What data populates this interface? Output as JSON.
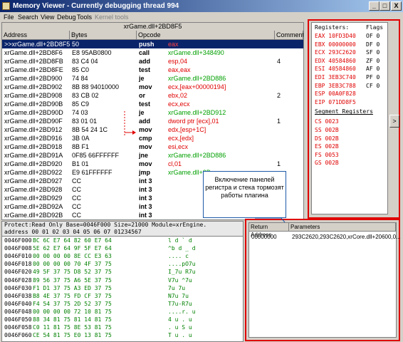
{
  "window": {
    "title": "Memory Viewer - Currently debugging thread 994",
    "minimize": "_",
    "maximize": "□",
    "close": "X"
  },
  "menu": [
    "File",
    "Search",
    "View",
    "Debug",
    "Tools",
    "Kernel tools"
  ],
  "disassembler": {
    "header": "xrGame.dll+2BD8F5",
    "columns": [
      "Address",
      "Bytes",
      "Opcode",
      "Comment"
    ],
    "rows": [
      {
        "addr": ">>xrGame.dll+2BD8F5",
        "bytes": "50",
        "mn": "push",
        "op": "eax",
        "cm": "",
        "sel": true
      },
      {
        "addr": "xrGame.dll+2BD8F6",
        "bytes": "E8 95AB0800",
        "mn": "call",
        "op": "xrGame.dll+348490",
        "cm": ""
      },
      {
        "addr": "xrGame.dll+2BD8FB",
        "bytes": "83 C4 04",
        "mn": "add",
        "op": "esp,04",
        "cm": "4"
      },
      {
        "addr": "xrGame.dll+2BD8FE",
        "bytes": "85 C0",
        "mn": "test",
        "op": "eax,eax",
        "cm": ""
      },
      {
        "addr": "xrGame.dll+2BD900",
        "bytes": "74 84",
        "mn": "je",
        "op": "xrGame.dll+2BD886",
        "cm": ""
      },
      {
        "addr": "xrGame.dll+2BD902",
        "bytes": "8B 88 94010000",
        "mn": "mov",
        "op": "ecx,[eax+00000194]",
        "cm": ""
      },
      {
        "addr": "xrGame.dll+2BD908",
        "bytes": "83 CB 02",
        "mn": "or",
        "op": "ebx,02",
        "cm": "2"
      },
      {
        "addr": "xrGame.dll+2BD90B",
        "bytes": "85 C9",
        "mn": "test",
        "op": "ecx,ecx",
        "cm": ""
      },
      {
        "addr": "xrGame.dll+2BD90D",
        "bytes": "74 03",
        "mn": "je",
        "op": "xrGame.dll+2BD912",
        "cm": ""
      },
      {
        "addr": "xrGame.dll+2BD90F",
        "bytes": "83 01 01",
        "mn": "add",
        "op": "dword ptr [ecx],01",
        "cm": "1"
      },
      {
        "addr": "xrGame.dll+2BD912",
        "bytes": "8B 54 24 1C",
        "mn": "mov",
        "op": "edx,[esp+1C]",
        "cm": ""
      },
      {
        "addr": "xrGame.dll+2BD916",
        "bytes": "3B 0A",
        "mn": "cmp",
        "op": "ecx,[edx]",
        "cm": ""
      },
      {
        "addr": "xrGame.dll+2BD918",
        "bytes": "8B F1",
        "mn": "mov",
        "op": "esi,ecx",
        "cm": ""
      },
      {
        "addr": "xrGame.dll+2BD91A",
        "bytes": "0F85 66FFFFFF",
        "mn": "jne",
        "op": "xrGame.dll+2BD886",
        "cm": ""
      },
      {
        "addr": "xrGame.dll+2BD920",
        "bytes": "B1 01",
        "mn": "mov",
        "op": "cl,01",
        "cm": "1"
      },
      {
        "addr": "xrGame.dll+2BD922",
        "bytes": "E9 61FFFFFF",
        "mn": "jmp",
        "op": "xrGame.dll+2B",
        "cm": ""
      },
      {
        "addr": "xrGame.dll+2BD927",
        "bytes": "CC",
        "mn": "int 3",
        "op": "",
        "cm": ""
      },
      {
        "addr": "xrGame.dll+2BD928",
        "bytes": "CC",
        "mn": "int 3",
        "op": "",
        "cm": ""
      },
      {
        "addr": "xrGame.dll+2BD929",
        "bytes": "CC",
        "mn": "int 3",
        "op": "",
        "cm": ""
      },
      {
        "addr": "xrGame.dll+2BD92A",
        "bytes": "CC",
        "mn": "int 3",
        "op": "",
        "cm": ""
      },
      {
        "addr": "xrGame.dll+2BD92B",
        "bytes": "CC",
        "mn": "int 3",
        "op": "",
        "cm": ""
      }
    ]
  },
  "annotation": "Включение панелей регистра и стека тормозят работы плагина",
  "registers": {
    "header": "Registers:",
    "flags_header": "Flags",
    "regs": [
      {
        "r": "EAX 10FD3D40",
        "f": "OF 0"
      },
      {
        "r": "EBX 00000000",
        "f": "DF 0"
      },
      {
        "r": "ECX 293C2620",
        "f": "SF 0"
      },
      {
        "r": "EDX 40584860",
        "f": "ZF 0"
      },
      {
        "r": "ESI 40584860",
        "f": "AF 0"
      },
      {
        "r": "EDI 3EB3C740",
        "f": "PF 0"
      },
      {
        "r": "EBP 3EB3C788",
        "f": "CF 0"
      },
      {
        "r": "ESP 00A0F828",
        "f": ""
      },
      {
        "r": "EIP 071DD8F5",
        "f": ""
      }
    ],
    "segment_header": "Segment Registers",
    "segments": [
      "CS 0023",
      "SS 002B",
      "DS 002B",
      "ES 002B",
      "FS 0053",
      "GS 002B"
    ],
    "expand_button": ">"
  },
  "memory": {
    "info": "Protect:Read Only  Base=0046F000 Size=21000 Module=xrEngine.",
    "columns": "address  00 01 02 03 04 05 06 07 01234567",
    "rows": [
      {
        "a": "0046F000",
        "h": "BC 6C E7 64 82 60 E7 64",
        "c": " l d ` d"
      },
      {
        "a": "0046F008",
        "h": "5E 62 E7 64 9F 5F E7 64",
        "c": "^b d _ d"
      },
      {
        "a": "0046F010",
        "h": "00 00 00 00 8E CC E3 63",
        "c": "....   c"
      },
      {
        "a": "0046F018",
        "h": "00 00 00 00 70 4F 37 75",
        "c": "....pO7u"
      },
      {
        "a": "0046F020",
        "h": "49 5F 37 75 D8 52 37 75",
        "c": "I_7u R7u"
      },
      {
        "a": "0046F028",
        "h": "89 56 37 75 A6 5E 37 75",
        "c": " V7u ^7u"
      },
      {
        "a": "0046F030",
        "h": "F1 D1 37 75 A3 ED 37 75",
        "c": "  7u  7u"
      },
      {
        "a": "0046F038",
        "h": "B8 4E 37 75 FD CF 37 75",
        "c": " N7u  7u"
      },
      {
        "a": "0046F040",
        "h": "F4 54 37 75 2D 52 37 75",
        "c": " T7u-R7u"
      },
      {
        "a": "0046F048",
        "h": "00 00 00 00 72 10 81 75",
        "c": "....r. u"
      },
      {
        "a": "0046F050",
        "h": "88 34 81 75 81 14 81 75",
        "c": " 4 u . u"
      },
      {
        "a": "0046F058",
        "h": "C0 11 81 75 8E 53 81 75",
        "c": ". u S u"
      },
      {
        "a": "0046F060",
        "h": "CE 54 81 75 E0 13 81 75",
        "c": "T u . u"
      }
    ]
  },
  "stack": {
    "columns": [
      "Return Address",
      "Parameters"
    ],
    "rows": [
      {
        "ret": "00000000",
        "params": "293C2620,293C2620,xrCore.dll+20600,0..."
      }
    ]
  }
}
